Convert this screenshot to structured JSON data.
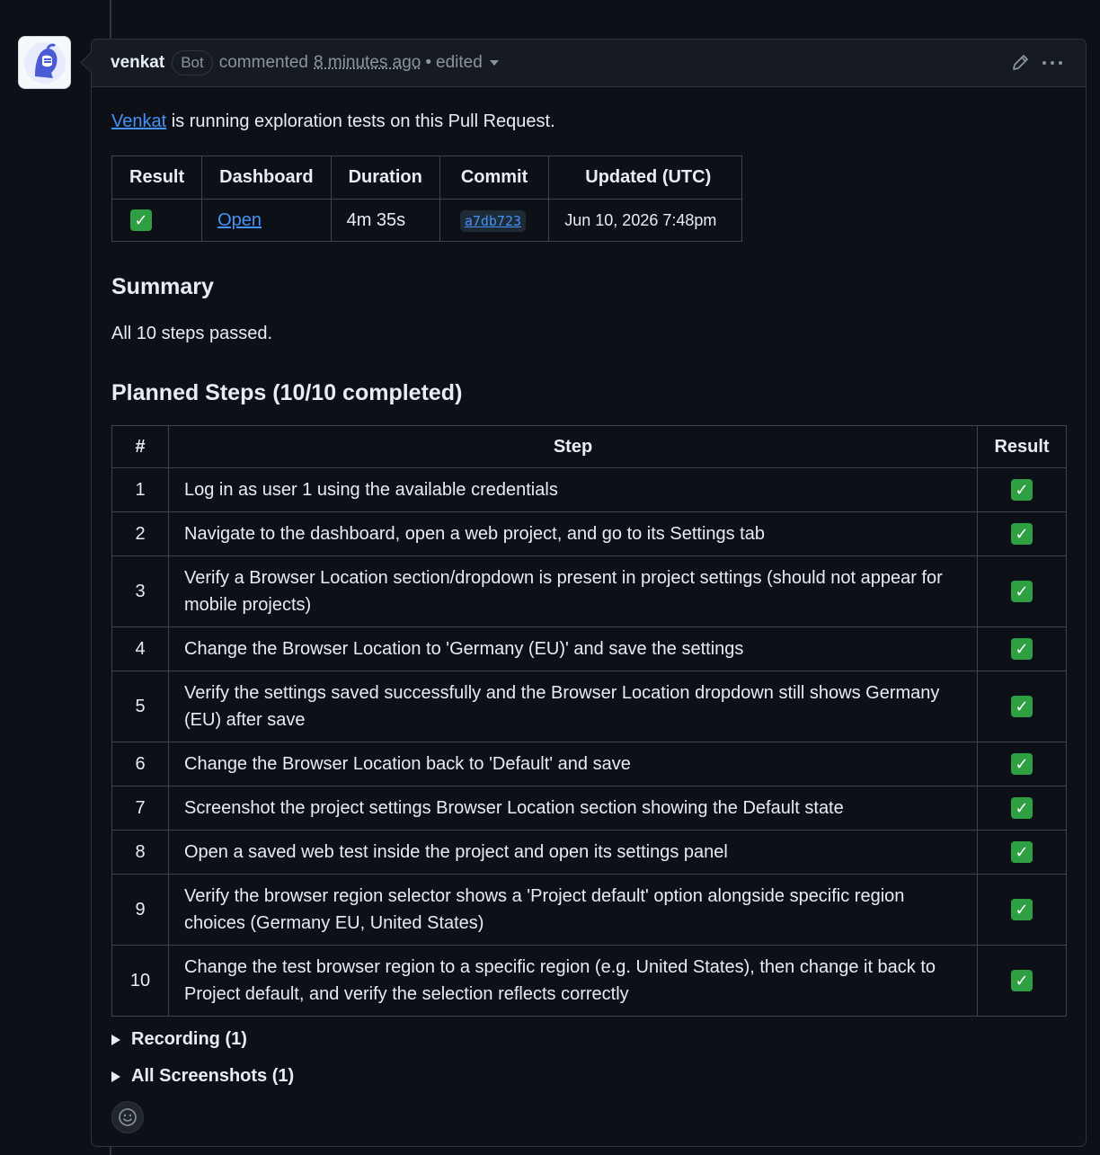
{
  "comment": {
    "author": "venkat",
    "badge": "Bot",
    "action": "commented",
    "time": "8 minutes ago",
    "separator": "•",
    "edited": "edited"
  },
  "intro": {
    "link": "Venkat",
    "text": " is running exploration tests on this Pull Request."
  },
  "info_table": {
    "headers": [
      "Result",
      "Dashboard",
      "Duration",
      "Commit",
      "Updated (UTC)"
    ],
    "row": {
      "result": "✓",
      "dashboard": "Open",
      "duration": "4m 35s",
      "commit": "a7db723",
      "updated": "Jun 10, 2026 7:48pm"
    }
  },
  "summary": {
    "title": "Summary",
    "text": "All 10 steps passed."
  },
  "steps": {
    "title": "Planned Steps (10/10 completed)",
    "headers": [
      "#",
      "Step",
      "Result"
    ],
    "rows": [
      {
        "num": "1",
        "step": "Log in as user 1 using the available credentials",
        "result": "✓"
      },
      {
        "num": "2",
        "step": "Navigate to the dashboard, open a web project, and go to its Settings tab",
        "result": "✓"
      },
      {
        "num": "3",
        "step": "Verify a Browser Location section/dropdown is present in project settings (should not appear for mobile projects)",
        "result": "✓"
      },
      {
        "num": "4",
        "step": "Change the Browser Location to 'Germany (EU)' and save the settings",
        "result": "✓"
      },
      {
        "num": "5",
        "step": "Verify the settings saved successfully and the Browser Location dropdown still shows Germany (EU) after save",
        "result": "✓"
      },
      {
        "num": "6",
        "step": "Change the Browser Location back to 'Default' and save",
        "result": "✓"
      },
      {
        "num": "7",
        "step": "Screenshot the project settings Browser Location section showing the Default state",
        "result": "✓"
      },
      {
        "num": "8",
        "step": "Open a saved web test inside the project and open its settings panel",
        "result": "✓"
      },
      {
        "num": "9",
        "step": "Verify the browser region selector shows a 'Project default' option alongside specific region choices (Germany EU, United States)",
        "result": "✓"
      },
      {
        "num": "10",
        "step": "Change the test browser region to a specific region (e.g. United States), then change it back to Project default, and verify the selection reflects correctly",
        "result": "✓"
      }
    ]
  },
  "details": {
    "recording": "Recording (1)",
    "screenshots": "All Screenshots (1)"
  },
  "icons": {
    "avatar": "knight-helmet-avatar-icon",
    "edit": "pencil-icon",
    "more": "kebab-menu-icon",
    "reaction": "smiley-icon",
    "check": "check-mark-icon"
  },
  "colors": {
    "background": "#0d1117",
    "link": "#4493f8",
    "check": "#2ea043",
    "border": "#30363d"
  }
}
